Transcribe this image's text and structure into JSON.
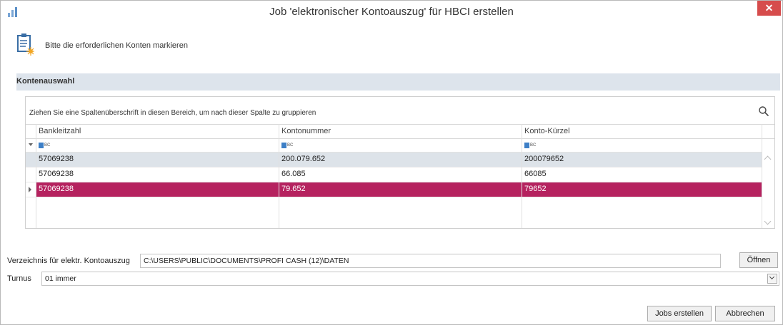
{
  "window": {
    "title": "Job 'elektronischer Kontoauszug' für HBCI erstellen",
    "close_label": "✕"
  },
  "header": {
    "instruction": "Bitte die erforderlichen Konten markieren"
  },
  "section": {
    "title": "Kontenauswahl"
  },
  "grid": {
    "group_hint": "Ziehen Sie eine Spaltenüberschrift in diesen Bereich, um nach dieser Spalte zu gruppieren",
    "columns": [
      "Bankleitzahl",
      "Kontonummer",
      "Konto-Kürzel"
    ],
    "filter_label": "BC",
    "rows": [
      [
        "57069238",
        "200.079.652",
        "200079652"
      ],
      [
        "57069238",
        "66.085",
        "66085"
      ],
      [
        "57069238",
        "79.652",
        "79652"
      ]
    ]
  },
  "directory": {
    "label": "Verzeichnis für elektr. Kontoauszug",
    "value": "C:\\USERS\\PUBLIC\\DOCUMENTS\\PROFI CASH (12)\\DATEN",
    "open_button": "Öffnen"
  },
  "turnus": {
    "label": "Turnus",
    "value": "01 immer"
  },
  "footer": {
    "create_button": "Jobs erstellen",
    "cancel_button": "Abbrechen"
  },
  "colors": {
    "selection": "#b5225f",
    "section_bar": "#dde4ec",
    "close": "#d64c4c"
  }
}
